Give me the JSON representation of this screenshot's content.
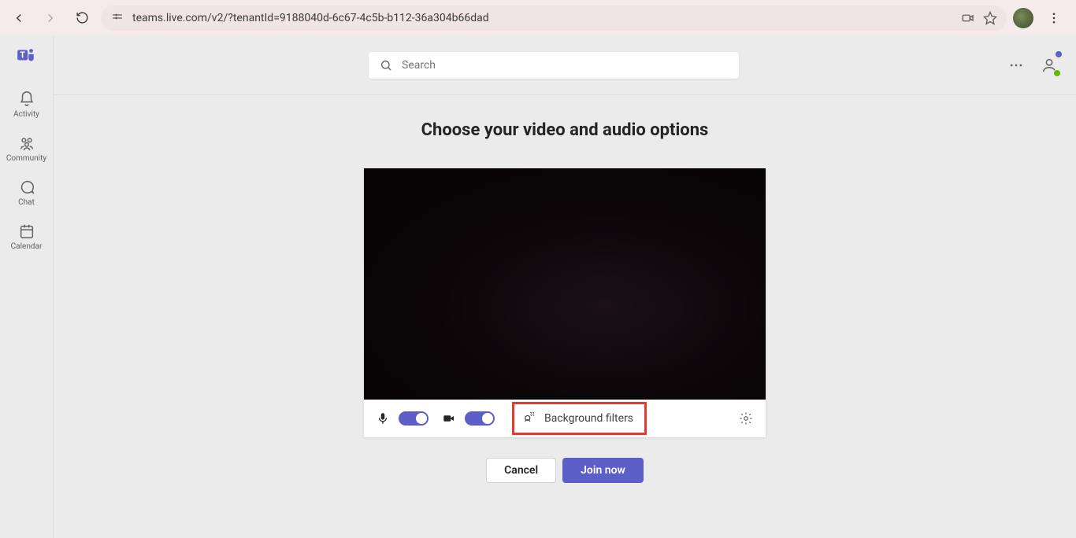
{
  "browser": {
    "url": "teams.live.com/v2/?tenantId=9188040d-6c67-4c5b-b112-36a304b66dad"
  },
  "search": {
    "placeholder": "Search"
  },
  "sidebar": {
    "items": [
      {
        "label": "Activity"
      },
      {
        "label": "Community"
      },
      {
        "label": "Chat"
      },
      {
        "label": "Calendar"
      }
    ]
  },
  "page": {
    "heading": "Choose your video and audio options",
    "background_filters_label": "Background filters",
    "cancel_label": "Cancel",
    "join_label": "Join now"
  },
  "colors": {
    "accent": "#5b5fc7",
    "highlight_border": "#e03c31"
  }
}
